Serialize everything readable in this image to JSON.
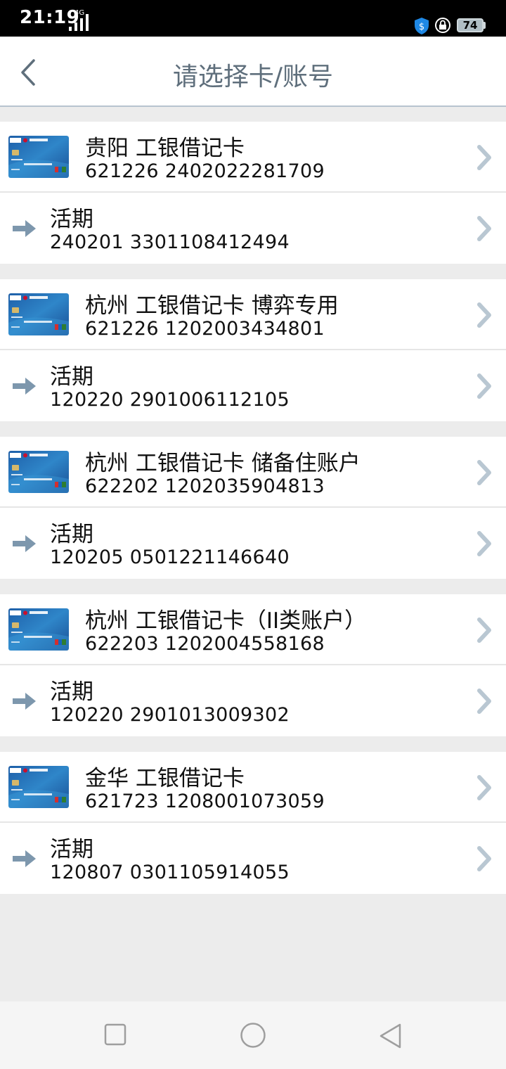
{
  "status_bar": {
    "time": "21:19",
    "network": "4G",
    "battery": "74",
    "icons": [
      "signal-icon",
      "shield-icon",
      "lock-icon",
      "battery-icon"
    ]
  },
  "header": {
    "title": "请选择卡/账号",
    "back_icon": "chevron-left-icon"
  },
  "colors": {
    "title_text": "#5f6f7c",
    "chevron": "#b9c7d2",
    "arrow": "#7d97ad",
    "background": "#ececec"
  },
  "cards": [
    {
      "card_title": "贵阳 工银借记卡",
      "card_number": "621226 2402022281709",
      "account_type": "活期",
      "account_number": "240201 3301108412494"
    },
    {
      "card_title": "杭州 工银借记卡 博弈专用",
      "card_number": "621226 1202003434801",
      "account_type": "活期",
      "account_number": "120220 2901006112105"
    },
    {
      "card_title": "杭州 工银借记卡 储备住账户",
      "card_number": "622202 1202035904813",
      "account_type": "活期",
      "account_number": "120205 0501221146640"
    },
    {
      "card_title": "杭州 工银借记卡（II类账户）",
      "card_number": "622203 1202004558168",
      "account_type": "活期",
      "account_number": "120220 2901013009302"
    },
    {
      "card_title": "金华 工银借记卡",
      "card_number": "621723 1208001073059",
      "account_type": "活期",
      "account_number": "120807 0301105914055"
    }
  ],
  "nav_bar": {
    "buttons": [
      "recents-square-icon",
      "home-circle-icon",
      "back-triangle-icon"
    ]
  }
}
